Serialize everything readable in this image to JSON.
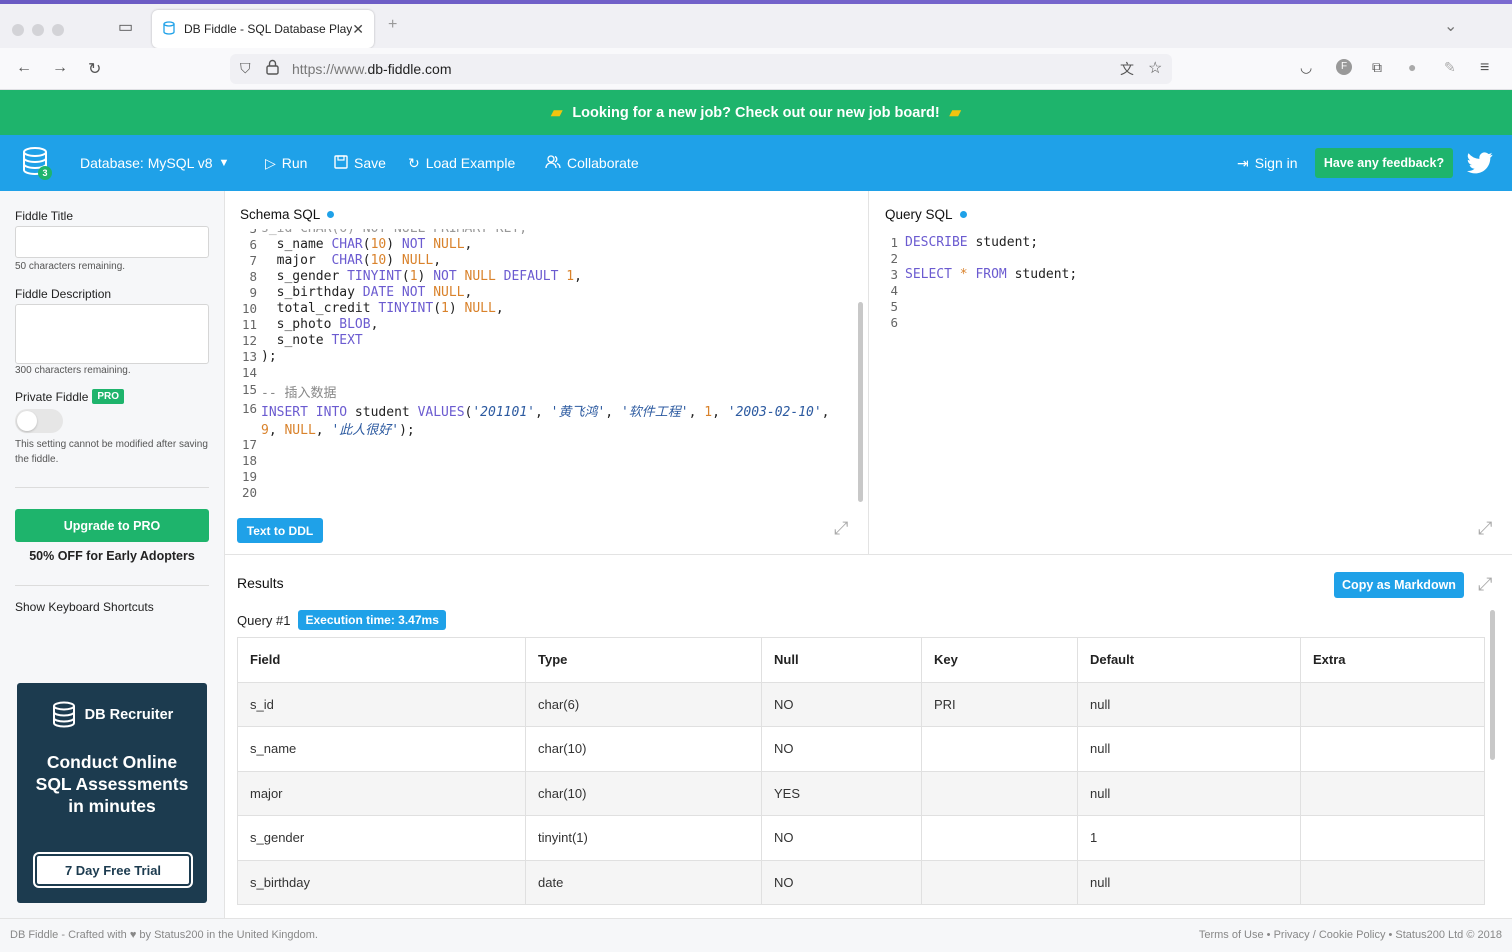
{
  "browser": {
    "tab_title": "DB Fiddle - SQL Database Playg",
    "url_prefix": "https://www.",
    "url_domain": "db-fiddle.com"
  },
  "banner": {
    "text": "Looking for a new job? Check out our new job board!"
  },
  "header": {
    "db_badge": "3",
    "database_label": "Database: MySQL v8",
    "run": "Run",
    "save": "Save",
    "load_example": "Load Example",
    "collaborate": "Collaborate",
    "sign_in": "Sign in",
    "feedback": "Have any feedback?"
  },
  "sidebar": {
    "fiddle_title_label": "Fiddle Title",
    "fiddle_title_value": "",
    "title_remaining": "50 characters remaining.",
    "description_label": "Fiddle Description",
    "description_value": "",
    "description_remaining": "300 characters remaining.",
    "private_label": "Private Fiddle",
    "pro_badge": "PRO",
    "private_note": "This setting cannot be modified after saving the fiddle.",
    "upgrade_button": "Upgrade to PRO",
    "upgrade_note": "50% OFF for Early Adopters",
    "shortcuts_link": "Show Keyboard Shortcuts",
    "ad": {
      "brand": "DB Recruiter",
      "headline": "Conduct Online SQL Assessments in minutes",
      "cta": "7 Day Free Trial"
    }
  },
  "schema": {
    "title": "Schema SQL",
    "text_to_ddl": "Text to DDL",
    "line_numbers": [
      "5",
      "6",
      "7",
      "8",
      "9",
      "10",
      "11",
      "12",
      "13",
      "14",
      "15",
      "16",
      "",
      "17",
      "18",
      "19",
      "20"
    ]
  },
  "query": {
    "title": "Query SQL",
    "line_numbers": [
      "1",
      "2",
      "3",
      "4",
      "5",
      "6"
    ]
  },
  "results": {
    "title": "Results",
    "copy_button": "Copy as Markdown",
    "query_label": "Query #1",
    "execution_time": "Execution time: 3.47ms",
    "columns": [
      "Field",
      "Type",
      "Null",
      "Key",
      "Default",
      "Extra"
    ],
    "rows": [
      [
        "s_id",
        "char(6)",
        "NO",
        "PRI",
        "null",
        ""
      ],
      [
        "s_name",
        "char(10)",
        "NO",
        "",
        "null",
        ""
      ],
      [
        "major",
        "char(10)",
        "YES",
        "",
        "null",
        ""
      ],
      [
        "s_gender",
        "tinyint(1)",
        "NO",
        "",
        "1",
        ""
      ],
      [
        "s_birthday",
        "date",
        "NO",
        "",
        "null",
        ""
      ]
    ]
  },
  "footer": {
    "left": "DB Fiddle - Crafted with ♥ by Status200 in the United Kingdom.",
    "right": "Terms of Use • Privacy / Cookie Policy • Status200 Ltd © 2018"
  },
  "colors": {
    "brand_blue": "#1fa1e8",
    "brand_green": "#1eb46c",
    "ad_navy": "#1c3b4f"
  }
}
